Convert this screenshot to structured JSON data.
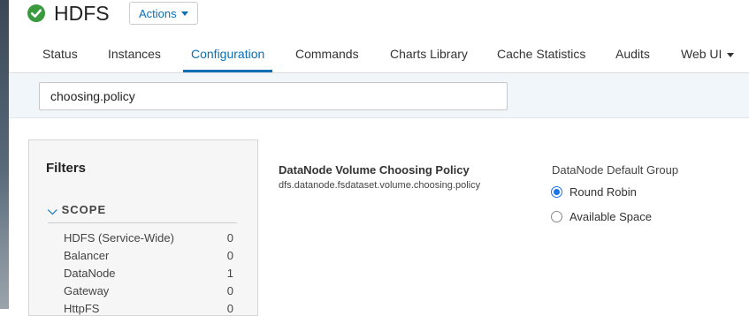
{
  "header": {
    "status_icon": "check-circle-icon",
    "service_name": "HDFS",
    "actions_label": "Actions"
  },
  "tabs": [
    {
      "label": "Status",
      "active": false
    },
    {
      "label": "Instances",
      "active": false
    },
    {
      "label": "Configuration",
      "active": true
    },
    {
      "label": "Commands",
      "active": false
    },
    {
      "label": "Charts Library",
      "active": false
    },
    {
      "label": "Cache Statistics",
      "active": false
    },
    {
      "label": "Audits",
      "active": false
    },
    {
      "label": "Web UI",
      "active": false,
      "dropdown": true
    }
  ],
  "search": {
    "value": "choosing.policy"
  },
  "filters": {
    "title": "Filters",
    "scope": {
      "label": "SCOPE",
      "items": [
        {
          "label": "HDFS (Service-Wide)",
          "count": "0"
        },
        {
          "label": "Balancer",
          "count": "0"
        },
        {
          "label": "DataNode",
          "count": "1"
        },
        {
          "label": "Gateway",
          "count": "0"
        },
        {
          "label": "HttpFS",
          "count": "0"
        }
      ]
    }
  },
  "property": {
    "name": "DataNode Volume Choosing Policy",
    "key": "dfs.datanode.fsdataset.volume.choosing.policy",
    "group_label": "DataNode Default Group",
    "options": [
      {
        "label": "Round Robin",
        "checked": true
      },
      {
        "label": "Available Space",
        "checked": false
      }
    ]
  },
  "colors": {
    "accent": "#0a6fb5",
    "status_ok": "#3a9a3e",
    "radio_selected": "#1a73e8"
  }
}
